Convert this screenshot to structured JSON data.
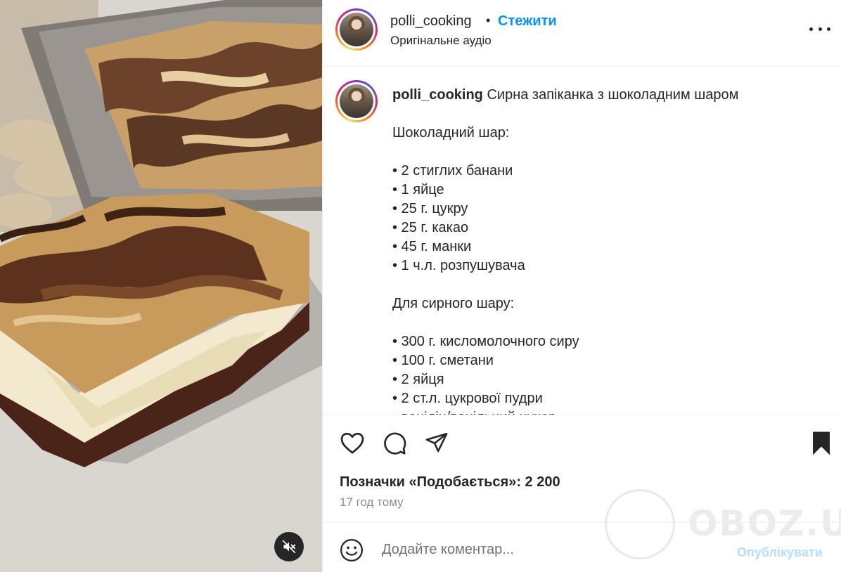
{
  "post": {
    "username": "polli_cooking",
    "separator": "•",
    "follow_label": "Стежити",
    "audio_label": "Оригінальне аудіо"
  },
  "caption": {
    "username": "polli_cooking",
    "title": "Сирна запіканка з шоколадним шаром",
    "lines": [
      "",
      "Шоколадний шар:",
      "",
      "• 2 стиглих банани",
      "• 1 яйце",
      "• 25 г. цукру",
      "• 25 г. какао",
      "• 45 г. манки",
      "• 1 ч.л. розпушувача",
      "",
      "Для сирного шару:",
      "",
      "• 300 г. кисломолочного сиру",
      "• 100 г. сметани",
      "• 2 яйця",
      "• 2 ст.л. цукрової пудри",
      "• ванілін/ванільний цукор"
    ]
  },
  "stats": {
    "likes_label": "Позначки «Подобається»: 2 200",
    "time_ago": "17 год тому"
  },
  "comment": {
    "placeholder": "Додайте коментар...",
    "publish_label": "Опублікувати"
  },
  "watermark": {
    "text": "OBOZ.UA"
  },
  "icons": {
    "like": "heart-icon",
    "comment": "comment-bubble-icon",
    "share": "paper-plane-icon",
    "save": "bookmark-icon",
    "more": "more-options-icon",
    "emoji": "smiley-icon",
    "mute": "speaker-muted-icon"
  },
  "colors": {
    "follow": "#0095f6",
    "publish_disabled": "#b2dffc",
    "text": "#262626",
    "secondary_text": "#8e8e8e"
  }
}
